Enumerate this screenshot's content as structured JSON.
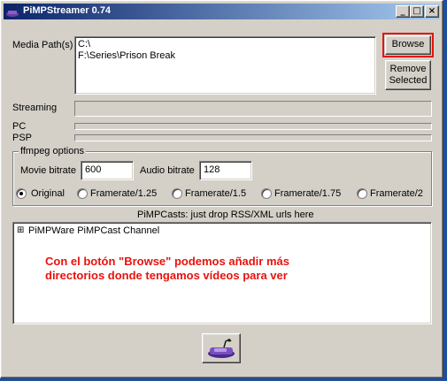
{
  "window": {
    "title": "PiMPStreamer 0.74",
    "minimize": "_",
    "maximize": "□",
    "close": "×"
  },
  "media": {
    "label": "Media Path(s)",
    "paths": [
      "C:\\",
      "F:\\Series\\Prison Break"
    ],
    "browse_label": "Browse",
    "remove_line1": "Remove",
    "remove_line2": "Selected",
    "highlight_color": "#e8120c"
  },
  "status": {
    "streaming_label": "Streaming",
    "pc_label": "PC",
    "psp_label": "PSP"
  },
  "ffmpeg": {
    "legend": "ffmpeg options",
    "movie_bitrate_label": "Movie bitrate",
    "movie_bitrate_value": "600",
    "audio_bitrate_label": "Audio bitrate",
    "audio_bitrate_value": "128",
    "framerates": [
      {
        "label": "Original",
        "selected": true
      },
      {
        "label": "Framerate/1.25",
        "selected": false
      },
      {
        "label": "Framerate/1.5",
        "selected": false
      },
      {
        "label": "Framerate/1.75",
        "selected": false
      },
      {
        "label": "Framerate/2",
        "selected": false
      }
    ]
  },
  "pimpcasts": {
    "heading": "PiMPCasts: just drop RSS/XML urls here",
    "tree_expander": "⊞",
    "channel": "PiMPWare PiMPCast Channel"
  },
  "annotation": {
    "line1": "Con el botón \"Browse\" podemos añadir más",
    "line2": "directorios donde tengamos vídeos para ver"
  },
  "footer": {
    "icon": "psp-icon"
  }
}
